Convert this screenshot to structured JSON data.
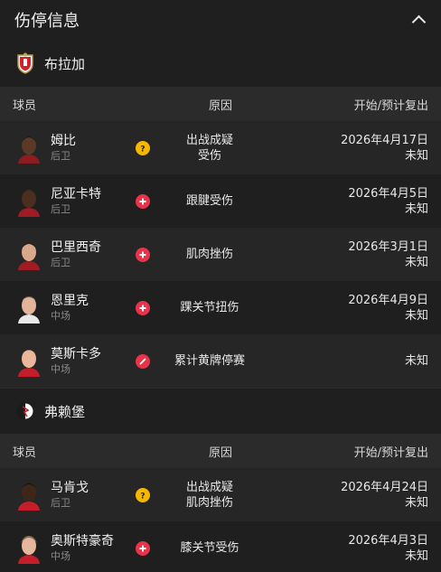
{
  "header": {
    "title": "伤停信息"
  },
  "columns": {
    "player": "球员",
    "reason": "原因",
    "dates": "开始/预计复出"
  },
  "teams": [
    {
      "name": "布拉加",
      "players": [
        {
          "name": "姆比",
          "position": "后卫",
          "status": "doubtful",
          "reason1": "出战成疑",
          "reason2": "受伤",
          "start": "2026年4月17日",
          "return": "未知"
        },
        {
          "name": "尼亚卡特",
          "position": "后卫",
          "status": "injury",
          "reason1": "跟腱受伤",
          "reason2": "",
          "start": "2026年4月5日",
          "return": "未知"
        },
        {
          "name": "巴里西奇",
          "position": "后卫",
          "status": "injury",
          "reason1": "肌肉挫伤",
          "reason2": "",
          "start": "2026年3月1日",
          "return": "未知"
        },
        {
          "name": "恩里克",
          "position": "中场",
          "status": "injury",
          "reason1": "踝关节扭伤",
          "reason2": "",
          "start": "2026年4月9日",
          "return": "未知"
        },
        {
          "name": "莫斯卡多",
          "position": "中场",
          "status": "suspended",
          "reason1": "累计黄牌停赛",
          "reason2": "",
          "start": "",
          "return": "未知"
        }
      ]
    },
    {
      "name": "弗赖堡",
      "players": [
        {
          "name": "马肯戈",
          "position": "后卫",
          "status": "doubtful",
          "reason1": "出战成疑",
          "reason2": "肌肉挫伤",
          "start": "2026年4月24日",
          "return": "未知"
        },
        {
          "name": "奥斯特豪奇",
          "position": "中场",
          "status": "injury",
          "reason1": "膝关节受伤",
          "reason2": "",
          "start": "2026年4月3日",
          "return": "未知"
        }
      ]
    }
  ],
  "colors": {
    "doubtful": "#f5b800",
    "injury": "#e8334a",
    "suspended": "#e8334a"
  }
}
